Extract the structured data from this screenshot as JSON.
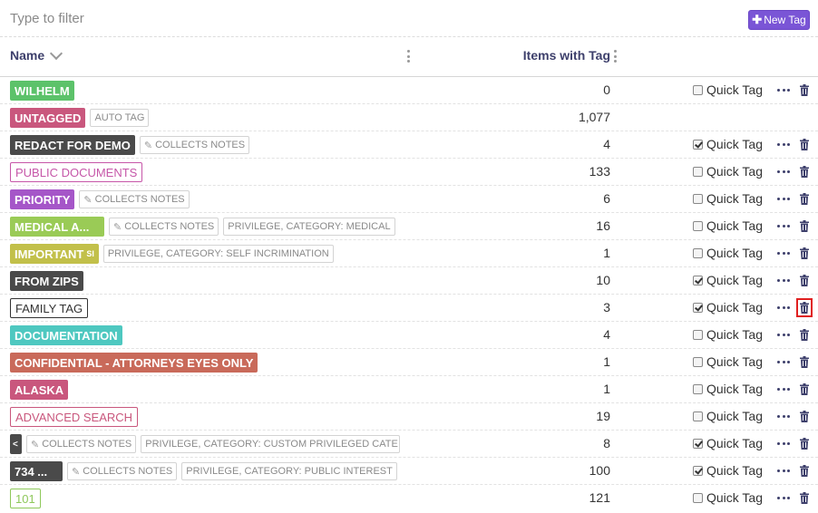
{
  "filter": {
    "placeholder": "Type to filter"
  },
  "new_tag_button": {
    "label": "New Tag",
    "icon": "plus-icon"
  },
  "columns": {
    "name": "Name",
    "items_with_tag": "Items with Tag"
  },
  "quick_tag_label": "Quick Tag",
  "collects_notes_label": "COLLECTS NOTES",
  "colors": {
    "accent": "#7a55d6",
    "header_text": "#3d3f6b",
    "highlight": "#e02020"
  },
  "rows": [
    {
      "tag": "WILHELM",
      "color": "#5cc26a",
      "style": "solid",
      "extras": [],
      "count": "0",
      "quick_tag": true,
      "quick_checked": false
    },
    {
      "tag": "UNTAGGED",
      "color": "#c9577d",
      "style": "solid",
      "extras": [
        {
          "text": "AUTO TAG",
          "icon": false
        }
      ],
      "count": "1,077",
      "quick_tag": false,
      "quick_checked": false
    },
    {
      "tag": "REDACT FOR DEMO",
      "color": "#4a4a4a",
      "style": "solid",
      "extras": [
        {
          "text": "COLLECTS NOTES",
          "icon": true
        }
      ],
      "count": "4",
      "quick_tag": true,
      "quick_checked": true
    },
    {
      "tag": "PUBLIC DOCUMENTS",
      "color": "#c656a8",
      "style": "outline",
      "extras": [],
      "count": "133",
      "quick_tag": true,
      "quick_checked": false
    },
    {
      "tag": "PRIORITY",
      "color": "#a556c8",
      "style": "solid",
      "extras": [
        {
          "text": "COLLECTS NOTES",
          "icon": true
        }
      ],
      "count": "6",
      "quick_tag": true,
      "quick_checked": false
    },
    {
      "tag": "MEDICAL A...",
      "color": "#9acb56",
      "style": "solid",
      "extras": [
        {
          "text": "COLLECTS NOTES",
          "icon": true
        },
        {
          "text": "PRIVILEGE, CATEGORY: MEDICAL",
          "icon": false
        }
      ],
      "count": "16",
      "quick_tag": true,
      "quick_checked": false
    },
    {
      "tag": "IMPORTANT",
      "tag_suffix": "SI",
      "color": "#c2c04a",
      "style": "solid",
      "extras": [
        {
          "text": "PRIVILEGE, CATEGORY: SELF INCRIMINATION",
          "icon": false
        }
      ],
      "count": "1",
      "quick_tag": true,
      "quick_checked": false
    },
    {
      "tag": "FROM ZIPS",
      "color": "#4a4a4a",
      "style": "solid",
      "extras": [],
      "count": "10",
      "quick_tag": true,
      "quick_checked": true
    },
    {
      "tag": "FAMILY TAG",
      "color": "#333333",
      "style": "outline",
      "extras": [],
      "count": "3",
      "quick_tag": true,
      "quick_checked": true,
      "highlight_delete": true
    },
    {
      "tag": "DOCUMENTATION",
      "color": "#4ec8c0",
      "style": "solid",
      "extras": [],
      "count": "4",
      "quick_tag": true,
      "quick_checked": false
    },
    {
      "tag": "CONFIDENTIAL - ATTORNEYS EYES ONLY",
      "color": "#c96a5a",
      "style": "solid",
      "extras": [],
      "count": "1",
      "quick_tag": true,
      "quick_checked": false
    },
    {
      "tag": "ALASKA",
      "color": "#c9577d",
      "style": "solid",
      "extras": [],
      "count": "1",
      "quick_tag": true,
      "quick_checked": false
    },
    {
      "tag": "ADVANCED SEARCH",
      "color": "#c9577d",
      "style": "outline",
      "extras": [],
      "count": "19",
      "quick_tag": true,
      "quick_checked": false
    },
    {
      "tag": "<",
      "color": "#4a4a4a",
      "style": "solid",
      "extras": [
        {
          "text": "COLLECTS NOTES",
          "icon": true
        },
        {
          "text": "PRIVILEGE, CATEGORY: CUSTOM PRIVILEGED CATE",
          "icon": false
        }
      ],
      "count": "8",
      "quick_tag": true,
      "quick_checked": true
    },
    {
      "tag": "734 ...",
      "color": "#4a4a4a",
      "style": "solid",
      "extras": [
        {
          "text": "COLLECTS NOTES",
          "icon": true
        },
        {
          "text": "PRIVILEGE, CATEGORY: PUBLIC INTEREST",
          "icon": false
        }
      ],
      "count": "100",
      "quick_tag": true,
      "quick_checked": true
    },
    {
      "tag": "101",
      "color": "#8ec85a",
      "style": "outline",
      "extras": [],
      "count": "121",
      "quick_tag": true,
      "quick_checked": false
    }
  ]
}
